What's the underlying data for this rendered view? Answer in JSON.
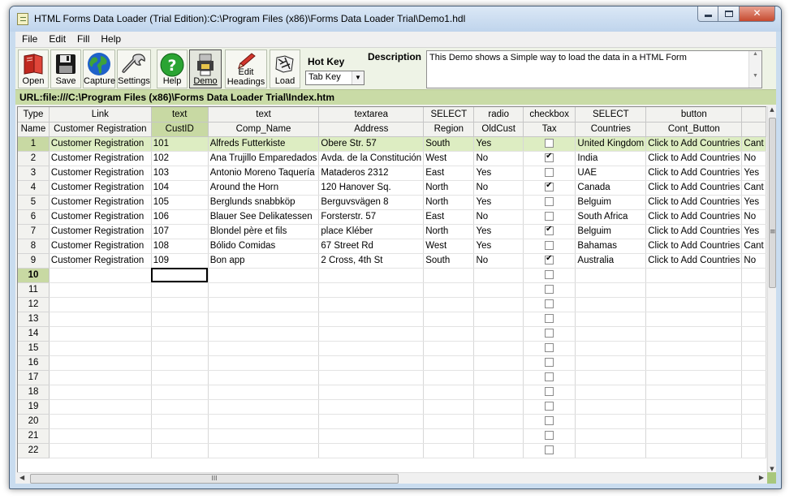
{
  "window": {
    "title": "HTML Forms Data Loader (Trial Edition):C:\\Program Files (x86)\\Forms Data Loader Trial\\Demo1.hdl",
    "minimize_icon": "minimize-icon",
    "maximize_icon": "maximize-icon",
    "close_glyph": "✕"
  },
  "menu": [
    "File",
    "Edit",
    "Fill",
    "Help"
  ],
  "toolbar": {
    "buttons": [
      {
        "label": "Open",
        "icon": "book-icon"
      },
      {
        "label": "Save",
        "icon": "floppy-disk-icon"
      },
      {
        "label": "Capture",
        "icon": "globe-icon"
      },
      {
        "label": "Settings",
        "icon": "wrench-icon"
      },
      {
        "label": "Help",
        "icon": "question-icon"
      },
      {
        "label": "Demo",
        "icon": "demo-icon",
        "pressed": true
      },
      {
        "label": "Edit\nHeadings",
        "icon": "pencil-icon"
      },
      {
        "label": "Load",
        "icon": "load-icon"
      }
    ],
    "hotkey_label": "Hot Key",
    "hotkey_value": "Tab Key",
    "description_label": "Description",
    "description_text": "This Demo shows a Simple way to load the data in a HTML Form"
  },
  "url": "URL:file:///C:\\Program Files (x86)\\Forms Data Loader Trial\\Index.htm",
  "grid": {
    "type_row": [
      "Type",
      "Link",
      "text",
      "text",
      "textarea",
      "SELECT",
      "radio",
      "checkbox",
      "SELECT",
      "button",
      ""
    ],
    "name_row": [
      "Name",
      "Customer Registration",
      "CustID",
      "Comp_Name",
      "Address",
      "Region",
      "OldCust",
      "Tax",
      "Countries",
      "Cont_Button",
      ""
    ],
    "rows": [
      {
        "num": "1",
        "cells": [
          "Customer Registration",
          "101",
          "Alfreds Futterkiste",
          "Obere Str. 57",
          "South",
          "Yes",
          false,
          "United Kingdom",
          "Click to Add Countries",
          "Cant"
        ]
      },
      {
        "num": "2",
        "cells": [
          "Customer Registration",
          "102",
          "Ana Trujillo Emparedados",
          "Avda. de la Constitución",
          "West",
          "No",
          true,
          "India",
          "Click to Add Countries",
          "No"
        ]
      },
      {
        "num": "3",
        "cells": [
          "Customer Registration",
          "103",
          "Antonio Moreno Taquería",
          "Mataderos  2312",
          "East",
          "Yes",
          false,
          "UAE",
          "Click to Add Countries",
          "Yes"
        ]
      },
      {
        "num": "4",
        "cells": [
          "Customer Registration",
          "104",
          "Around the Horn",
          "120 Hanover Sq.",
          "North",
          "No",
          true,
          "Canada",
          "Click to Add Countries",
          "Cant"
        ]
      },
      {
        "num": "5",
        "cells": [
          "Customer Registration",
          "105",
          "Berglunds snabbköp",
          "Berguvsvägen  8",
          "North",
          "Yes",
          false,
          "Belguim",
          "Click to Add Countries",
          "Yes"
        ]
      },
      {
        "num": "6",
        "cells": [
          "Customer Registration",
          "106",
          "Blauer See Delikatessen",
          "Forsterstr. 57",
          "East",
          "No",
          false,
          "South Africa",
          "Click to Add Countries",
          "No"
        ]
      },
      {
        "num": "7",
        "cells": [
          "Customer Registration",
          "107",
          "Blondel père et fils",
          " place Kléber",
          "North",
          "Yes",
          true,
          "Belguim",
          "Click to Add Countries",
          "Yes"
        ]
      },
      {
        "num": "8",
        "cells": [
          "Customer Registration",
          "108",
          "Bólido Comidas",
          " 67 Street Rd",
          "West",
          "Yes",
          false,
          "Bahamas",
          "Click to Add Countries",
          "Cant"
        ]
      },
      {
        "num": "9",
        "cells": [
          "Customer Registration",
          "109",
          "Bon app",
          "2 Cross, 4th St",
          "South",
          "No",
          true,
          "Australia",
          "Click to Add Countries",
          "No"
        ]
      }
    ],
    "empty_rows": [
      "10",
      "11",
      "12",
      "13",
      "14",
      "15",
      "16",
      "17",
      "18",
      "19",
      "20",
      "21",
      "22"
    ]
  },
  "scrollbar": {
    "grip": "III",
    "vgrip": "≡"
  }
}
